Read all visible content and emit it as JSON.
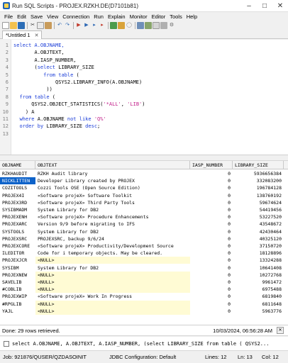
{
  "window": {
    "title": "Run SQL Scripts - PROJEX.RZKH.DE(D7101b81)"
  },
  "menu": [
    "File",
    "Edit",
    "Save",
    "View",
    "Connection",
    "Run",
    "Explain",
    "Monitor",
    "Editor",
    "Tools",
    "Help"
  ],
  "tab": {
    "label": "*Untitled 1"
  },
  "editor": {
    "line_numbers": [
      "1",
      "2",
      "3",
      "4",
      "5",
      "6",
      "7",
      "8",
      "9",
      "10",
      "11",
      "12",
      "13"
    ],
    "lines": [
      [
        {
          "t": "select A.OBJNAME,",
          "c": "kw0"
        }
      ],
      [
        {
          "t": "       A.OBJTEXT,",
          "c": ""
        }
      ],
      [
        {
          "t": "       A.IASP_NUMBER,",
          "c": ""
        }
      ],
      [
        {
          "t": "       (",
          "c": ""
        },
        {
          "t": "select",
          "c": "kw"
        },
        {
          "t": " LIBRARY_SIZE",
          "c": ""
        }
      ],
      [
        {
          "t": "          ",
          "c": ""
        },
        {
          "t": "from table",
          "c": "kw"
        },
        {
          "t": " (",
          "c": ""
        }
      ],
      [
        {
          "t": "              QSYS2.LIBRARY_INFO(A.OBJNAME)",
          "c": ""
        }
      ],
      [
        {
          "t": "           ))",
          "c": ""
        }
      ],
      [
        {
          "t": "  ",
          "c": ""
        },
        {
          "t": "from table",
          "c": "kw"
        },
        {
          "t": " (",
          "c": ""
        }
      ],
      [
        {
          "t": "      QSYS2.OBJECT_STATISTICS(",
          "c": ""
        },
        {
          "t": "'*ALL'",
          "c": "str"
        },
        {
          "t": ", ",
          "c": ""
        },
        {
          "t": "'LIB'",
          "c": "str"
        },
        {
          "t": ")",
          "c": ""
        }
      ],
      [
        {
          "t": "    ) A",
          "c": ""
        }
      ],
      [
        {
          "t": "  ",
          "c": ""
        },
        {
          "t": "where",
          "c": "kw"
        },
        {
          "t": " A.OBJNAME ",
          "c": ""
        },
        {
          "t": "not like",
          "c": "kw"
        },
        {
          "t": " ",
          "c": ""
        },
        {
          "t": "'Q%'",
          "c": "str"
        }
      ],
      [
        {
          "t": "  ",
          "c": ""
        },
        {
          "t": "order by",
          "c": "kw"
        },
        {
          "t": " LIBRARY_SIZE ",
          "c": ""
        },
        {
          "t": "desc",
          "c": "kw"
        },
        {
          "t": ";",
          "c": ""
        }
      ],
      [
        {
          "t": "",
          "c": ""
        }
      ]
    ]
  },
  "results": {
    "columns": [
      "OBJNAME",
      "OBJTEXT",
      "IASP_NUMBER",
      "LIBRARY_SIZE"
    ],
    "rows": [
      [
        "RZKHAUDIT",
        "RZKH Audit library",
        "0",
        "5936656384"
      ],
      [
        "NICKLITTEN",
        "Developer Library created by PROJEX",
        "0",
        "332083200"
      ],
      [
        "COZITOOLS",
        "Cozzi Tools OSE (Open Source Edition)",
        "0",
        "196784128"
      ],
      [
        "PROJEX4I",
        "«Software projeX» Software Toolkit",
        "0",
        "138760192"
      ],
      [
        "PROJEX3RD",
        "«Software projeX» Third Party Tools",
        "0",
        "59674624"
      ],
      [
        "SYSIBMADM",
        "System Library for DB2",
        "0",
        "54419456"
      ],
      [
        "PROJEXENH",
        "«Software projeX» Procedure Enhancements",
        "0",
        "53227520"
      ],
      [
        "PROJEXARC",
        "Version 9/9 before migrating to IFS",
        "0",
        "43548672"
      ],
      [
        "SYSTOOLS",
        "System Library for DB2",
        "0",
        "42430464"
      ],
      [
        "PROJEXSRC",
        "PROJEXSRC, backup 9/6/24",
        "0",
        "40325120"
      ],
      [
        "PROJEXCORE",
        "«Software projeX» Productivity/Development Source",
        "0",
        "37150720"
      ],
      [
        "ILEDITOR",
        "Code for i temporary objects. May be cleared.",
        "0",
        "18128896"
      ],
      [
        "PROJEXJCR",
        "<NULL>",
        "0",
        "13324288"
      ],
      [
        "SYSIBM",
        "System Library for DB2",
        "0",
        "10641408"
      ],
      [
        "PROJEXNEW",
        "<NULL>",
        "0",
        "10272768"
      ],
      [
        "SAVELIB",
        "<NULL>",
        "0",
        "9961472"
      ],
      [
        "#COBLIB",
        "<NULL>",
        "0",
        "6975488"
      ],
      [
        "PROJEXWIP",
        "«Software projeX» Work In Progress",
        "0",
        "6819840"
      ],
      [
        "#RPGLIB",
        "<NULL>",
        "0",
        "6811648"
      ],
      [
        "YAJL",
        "<NULL>",
        "0",
        "5963776"
      ],
      [
        "",
        "",
        "",
        ""
      ]
    ],
    "selected_row": 1
  },
  "status": {
    "message": "Done: 29 rows retrieved.",
    "timestamp": "10/03/2024, 06:56:28 AM"
  },
  "log": {
    "text": "select A.OBJNAME, A.OBJTEXT, A.IASP_NUMBER, (select LIBRARY_SIZE from table ( QSYS2..."
  },
  "bottom": {
    "job": "Job: 921876/QUSER/QZDASOINIT",
    "jdbc": "JDBC Configuration: Default",
    "lines": "Lines: 12",
    "ln": "Ln: 13",
    "col": "Col: 12"
  }
}
